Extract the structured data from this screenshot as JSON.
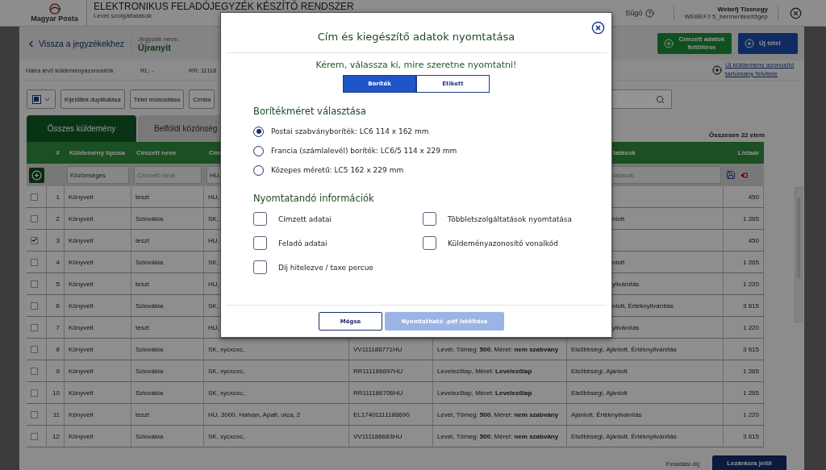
{
  "header": {
    "logo": "Magyar Posta",
    "title": "ELEKTRONIKUS FELADÓJEGYZÉK KÉSZÍTŐ RENDSZER",
    "subtitle": "Levél szolgáltatások",
    "help": "Súgó",
    "user_name": "Webefj Tizenegy",
    "user_org": "WEBEFJ 5_bérmentesítőgép"
  },
  "subheader": {
    "back_link": "Vissza a jegyzékekhez",
    "list_label": "Jegyzék neve:",
    "list_name": "Újranyit",
    "buttons": [
      {
        "label": "Címzett adatok feltöltése",
        "kind": "upload"
      },
      {
        "label": "Új tétel",
        "kind": "new"
      }
    ]
  },
  "ids_bar": {
    "label": "Hátra lévő küldeményazonosítók",
    "rl": "RL: -",
    "rr": "RR: 11118",
    "add_link": "Új küldemény azonosító tartomány felvitele"
  },
  "toolbar": {
    "buttons": [
      "Kijelöltek duplikálása",
      "Tétel módosítása",
      "Címira"
    ]
  },
  "tabs": [
    {
      "label": "Összes küldemény",
      "selected": true
    },
    {
      "label": "Belföldi közönség",
      "selected": false
    }
  ],
  "total": "Összesen 22 elem",
  "table": {
    "columns": [
      "#",
      "Küldemény típusa",
      "Címzett neve",
      "Cím",
      "tatások",
      "Listaár"
    ],
    "filters": {
      "type": "Közönséges",
      "name_placeholder": "Címzett neve",
      "address": "HU,",
      "services_placeholder": "tatások"
    },
    "rows": [
      {
        "kind": "covered",
        "checked": false,
        "no": "1",
        "type": "Könyvelt",
        "name": "teszt",
        "address": "HU,",
        "price": "450"
      },
      {
        "kind": "covered",
        "checked": false,
        "no": "2",
        "type": "Könyvelt",
        "name": "Szlovákia",
        "address": "SK,",
        "services": "nlott",
        "price": "1 265"
      },
      {
        "kind": "covered",
        "checked": true,
        "no": "3",
        "type": "Könyvelt",
        "name": "teszt",
        "address": "HU,",
        "price": "450"
      },
      {
        "kind": "covered",
        "checked": false,
        "no": "4",
        "type": "Könyvelt",
        "name": "Szlovákia",
        "address": "SK,",
        "services": "nlott",
        "price": "1 265"
      },
      {
        "kind": "covered",
        "checked": false,
        "no": "5",
        "type": "Könyvelt",
        "name": "teszt",
        "address": "HU,",
        "services": "yilvánítás",
        "price": "1 220"
      },
      {
        "kind": "covered",
        "checked": false,
        "no": "6",
        "type": "Könyvelt",
        "name": "Szlovákia",
        "address": "SK,",
        "services": "nlott, Értéknyilvánítás",
        "price": "3 615"
      },
      {
        "kind": "covered",
        "checked": false,
        "no": "7",
        "type": "Könyvelt",
        "name": "teszt",
        "address": "HU,",
        "services": "yilvánítás",
        "price": "1 220"
      },
      {
        "kind": "full",
        "checked": false,
        "no": "8",
        "type": "Könyvelt",
        "name": "Szlovákia",
        "address": "SK, xycxcxc,",
        "id": "VV111186771HU",
        "desc": "Levél, Tömeg: **500**, Méret: **nem szabvány**",
        "services": "Elsőbbségi, Ajánlott, Értéknyilvánítás",
        "price": "3 615"
      },
      {
        "kind": "full",
        "checked": false,
        "no": "9",
        "type": "Könyvelt",
        "name": "Szlovákia",
        "address": "SK, xycxcxc,",
        "id": "RR111186697HU",
        "desc": "Levelezőlap, Méret: **Levelezőlap**",
        "services": "Elsőbbségi, Ajánlott",
        "price": "1 265"
      },
      {
        "kind": "full",
        "checked": false,
        "no": "10",
        "type": "Könyvelt",
        "name": "Szlovákia",
        "address": "SK, xycxcxc,",
        "id": "RR111186706HU",
        "desc": "Levelezőlap, Méret: **Levelezőlap**",
        "services": "Elsőbbségi, Ajánlott",
        "price": "1 265"
      },
      {
        "kind": "full",
        "checked": false,
        "no": "11",
        "type": "Könyvelt",
        "name": "teszt",
        "address": "HU, 3000, Hatvan, Apafi, utca, 2",
        "id": "EL17401111186690",
        "desc": "Levél, Tömeg: **500**, Méret: **nem szabvány**",
        "services": "Ajánlott, Értéknyilvánítás",
        "price": "1 220"
      },
      {
        "kind": "full",
        "checked": false,
        "no": "12",
        "type": "Könyvelt",
        "name": "Szlovákia",
        "address": "SK, xycxcxc,",
        "id": "VV111186683HU",
        "desc": "Levél, Tömeg: **500**, Méret: **nem szabvány**",
        "services": "Elsőbbségi, Ajánlott, Értéknyilvánítás",
        "price": "3 615"
      }
    ]
  },
  "footer": {
    "fee_label": "Feladási díj:",
    "close_button": "Lezárásra jelöl"
  },
  "dialog": {
    "title": "Cím és kiegészítő adatok nyomtatása",
    "prompt": "Kérem, válassza ki, mire szeretne nyomtatni!",
    "modes": [
      {
        "label": "Boríték",
        "selected": true
      },
      {
        "label": "Etikett",
        "selected": false
      }
    ],
    "size_heading": "Borítékméret választása",
    "sizes": [
      {
        "label": "Postai szabványboríték: LC6 114 x 162 mm",
        "selected": true
      },
      {
        "label": "Francia (számlalevél) boríték: LC6/5 114 x 229 mm",
        "selected": false
      },
      {
        "label": "Közepes méretű: LC5 162 x 229 mm",
        "selected": false
      }
    ],
    "info_heading": "Nyomtatandó információk",
    "options": [
      {
        "label": "Címzett adatai",
        "checked": false
      },
      {
        "label": "Többletszolgáltatások nyomtatása",
        "checked": false
      },
      {
        "label": "Feladó adatai",
        "checked": false
      },
      {
        "label": "Küldeményazonosító vonalkód",
        "checked": false
      },
      {
        "label": "Díj hitelezve / taxe percue",
        "checked": false
      }
    ],
    "cancel": "Mégse",
    "download": {
      "label": "Nyomtatható .pdf letöltése",
      "disabled": true
    }
  }
}
